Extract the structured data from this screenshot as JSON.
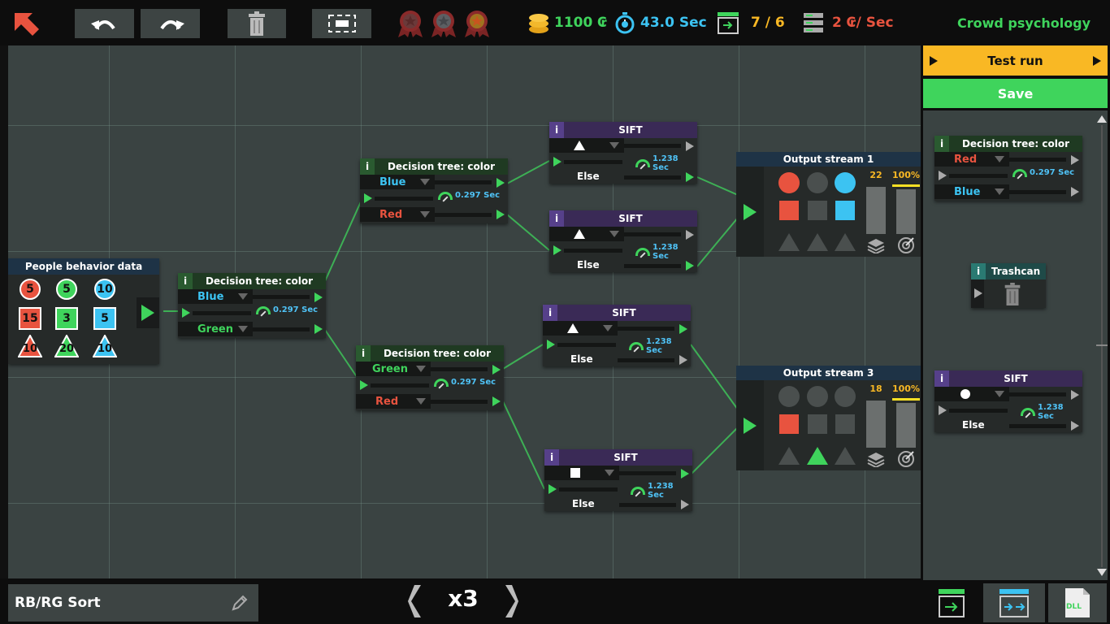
{
  "topbar": {
    "coins": "1100 ₢",
    "time": "43.0 Sec",
    "outputs": "7 / 6",
    "cost": "2 ₢/ Sec",
    "level_title": "Crowd psychology"
  },
  "colors": {
    "green": "#3fd45c",
    "red": "#e8533f",
    "blue": "#3cc3f2",
    "yellow": "#f9b824",
    "gray": "#4a4f4e"
  },
  "source": {
    "title": "People behavior data",
    "circles": [
      "5",
      "5",
      "10"
    ],
    "squares": [
      "15",
      "3",
      "5"
    ],
    "triangles": [
      "10",
      "20",
      "10"
    ]
  },
  "dt1": {
    "title": "Decision tree: color",
    "opt1": "Blue",
    "opt2": "Green",
    "speed": "0.297 Sec",
    "info": "i"
  },
  "dt2": {
    "title": "Decision tree: color",
    "opt1": "Blue",
    "opt2": "Red",
    "speed": "0.297 Sec",
    "info": "i"
  },
  "dt3": {
    "title": "Decision tree: color",
    "opt1": "Green",
    "opt2": "Red",
    "speed": "0.297 Sec",
    "info": "i"
  },
  "sift1": {
    "title": "SIFT",
    "else": "Else",
    "speed": "1.238 Sec",
    "shape": "triangle",
    "info": "i"
  },
  "sift2": {
    "title": "SIFT",
    "else": "Else",
    "speed": "1.238 Sec",
    "shape": "triangle",
    "info": "i"
  },
  "sift3": {
    "title": "SIFT",
    "else": "Else",
    "speed": "1.238 Sec",
    "shape": "triangle",
    "info": "i"
  },
  "sift4": {
    "title": "SIFT",
    "else": "Else",
    "speed": "1.238 Sec",
    "shape": "square",
    "info": "i"
  },
  "out1": {
    "title": "Output stream 1",
    "count": "22",
    "percent": "100%"
  },
  "out3": {
    "title": "Output stream 3",
    "count": "18",
    "percent": "100%"
  },
  "panel": {
    "test_run": "Test run",
    "save": "Save",
    "lib_dt": {
      "title": "Decision tree: color",
      "opt1": "Red",
      "opt2": "Blue",
      "speed": "0.297 Sec",
      "info": "i"
    },
    "lib_trash": {
      "title": "Trashcan",
      "info": "i"
    },
    "lib_sift": {
      "title": "SIFT",
      "else": "Else",
      "speed": "1.238 Sec",
      "shape": "circle",
      "info": "i"
    }
  },
  "bottom": {
    "solution_name": "RB/RG Sort",
    "speed_multiplier": "x3",
    "tab3_label": "DLL"
  }
}
